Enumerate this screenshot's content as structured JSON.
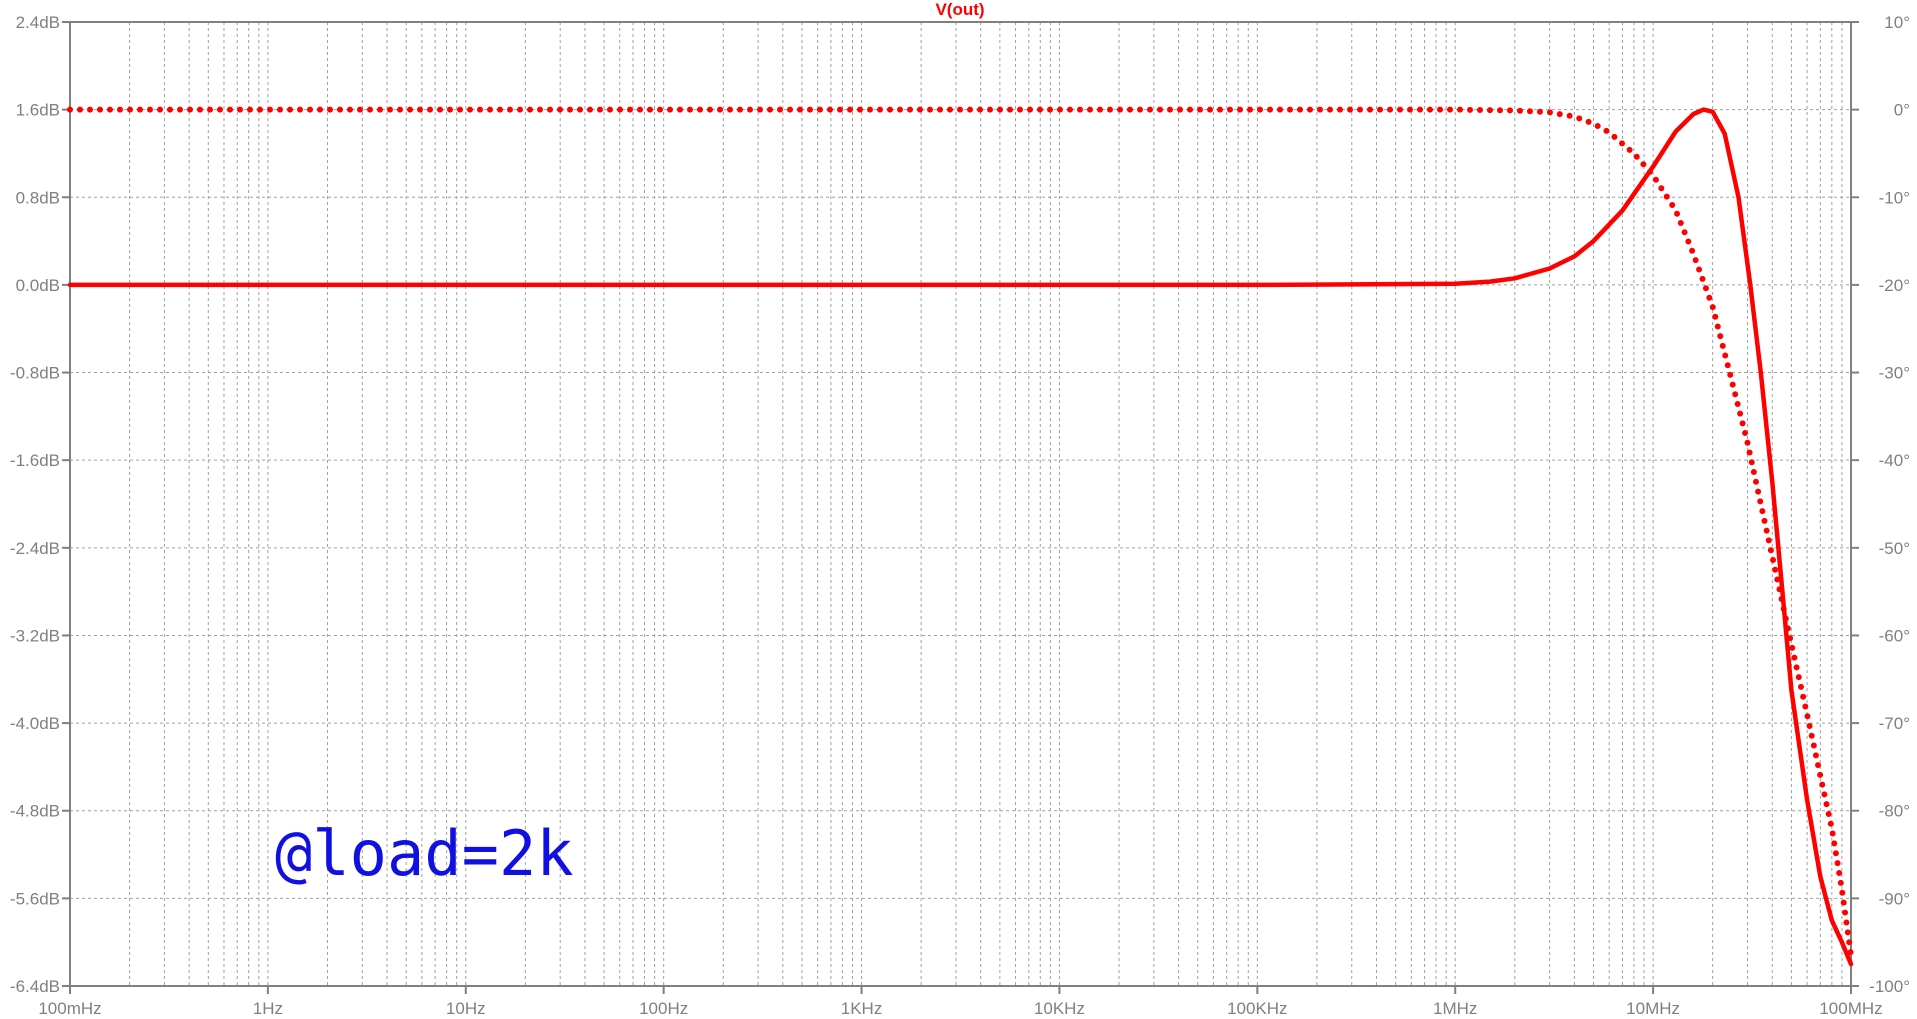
{
  "chart_data": {
    "type": "line",
    "title": "V(out)",
    "x_scale": "log",
    "xlim": [
      0.1,
      100000000
    ],
    "x_ticks": [
      {
        "value": 0.1,
        "label": "100mHz"
      },
      {
        "value": 1,
        "label": "1Hz"
      },
      {
        "value": 10,
        "label": "10Hz"
      },
      {
        "value": 100,
        "label": "100Hz"
      },
      {
        "value": 1000,
        "label": "1KHz"
      },
      {
        "value": 10000,
        "label": "10KHz"
      },
      {
        "value": 100000,
        "label": "100KHz"
      },
      {
        "value": 1000000,
        "label": "1MHz"
      },
      {
        "value": 10000000,
        "label": "10MHz"
      },
      {
        "value": 100000000,
        "label": "100MHz"
      }
    ],
    "ylim_left": [
      -6.4,
      2.4
    ],
    "y_ticks_left": [
      "2.4dB",
      "1.6dB",
      "0.8dB",
      "0.0dB",
      "-0.8dB",
      "-1.6dB",
      "-2.4dB",
      "-3.2dB",
      "-4.0dB",
      "-4.8dB",
      "-5.6dB",
      "-6.4dB"
    ],
    "ylim_right": [
      -100,
      10
    ],
    "y_ticks_right": [
      "10°",
      "0°",
      "-10°",
      "-20°",
      "-30°",
      "-40°",
      "-50°",
      "-60°",
      "-70°",
      "-80°",
      "-90°",
      "-100°"
    ],
    "grid": true,
    "annotation": "@load=2k",
    "colors": {
      "trace": "#ff0000",
      "annotation": "#1010e0",
      "axis": "#808080",
      "grid": "#a0a0a0"
    },
    "series": [
      {
        "quantity": "magnitude",
        "axis": "left",
        "style": "solid",
        "points": [
          [
            0.1,
            0.0
          ],
          [
            100000,
            0.0
          ],
          [
            1000000,
            0.01
          ],
          [
            1500000,
            0.03
          ],
          [
            2000000,
            0.06
          ],
          [
            3000000,
            0.15
          ],
          [
            4000000,
            0.26
          ],
          [
            5000000,
            0.4
          ],
          [
            7000000,
            0.68
          ],
          [
            10000000,
            1.08
          ],
          [
            13000000,
            1.4
          ],
          [
            16000000,
            1.56
          ],
          [
            18000000,
            1.6
          ],
          [
            20000000,
            1.58
          ],
          [
            23000000,
            1.38
          ],
          [
            27000000,
            0.8
          ],
          [
            31000000,
            0.0
          ],
          [
            35000000,
            -0.8
          ],
          [
            40000000,
            -1.8
          ],
          [
            45000000,
            -2.8
          ],
          [
            50000000,
            -3.7
          ],
          [
            60000000,
            -4.7
          ],
          [
            70000000,
            -5.4
          ],
          [
            80000000,
            -5.8
          ],
          [
            90000000,
            -6.0
          ],
          [
            100000000,
            -6.2
          ]
        ]
      },
      {
        "quantity": "phase",
        "axis": "right",
        "style": "dotted",
        "points": [
          [
            0.1,
            0.0
          ],
          [
            1000000,
            0.0
          ],
          [
            2000000,
            -0.1
          ],
          [
            3000000,
            -0.3
          ],
          [
            4000000,
            -0.8
          ],
          [
            5000000,
            -1.6
          ],
          [
            6000000,
            -2.6
          ],
          [
            8000000,
            -5.0
          ],
          [
            10000000,
            -7.5
          ],
          [
            13000000,
            -11.5
          ],
          [
            16000000,
            -16.5
          ],
          [
            20000000,
            -22.5
          ],
          [
            25000000,
            -31
          ],
          [
            30000000,
            -38
          ],
          [
            35000000,
            -45
          ],
          [
            40000000,
            -51
          ],
          [
            50000000,
            -61
          ],
          [
            60000000,
            -69
          ],
          [
            70000000,
            -76
          ],
          [
            80000000,
            -82
          ],
          [
            90000000,
            -89
          ],
          [
            100000000,
            -96.5
          ]
        ]
      }
    ]
  }
}
